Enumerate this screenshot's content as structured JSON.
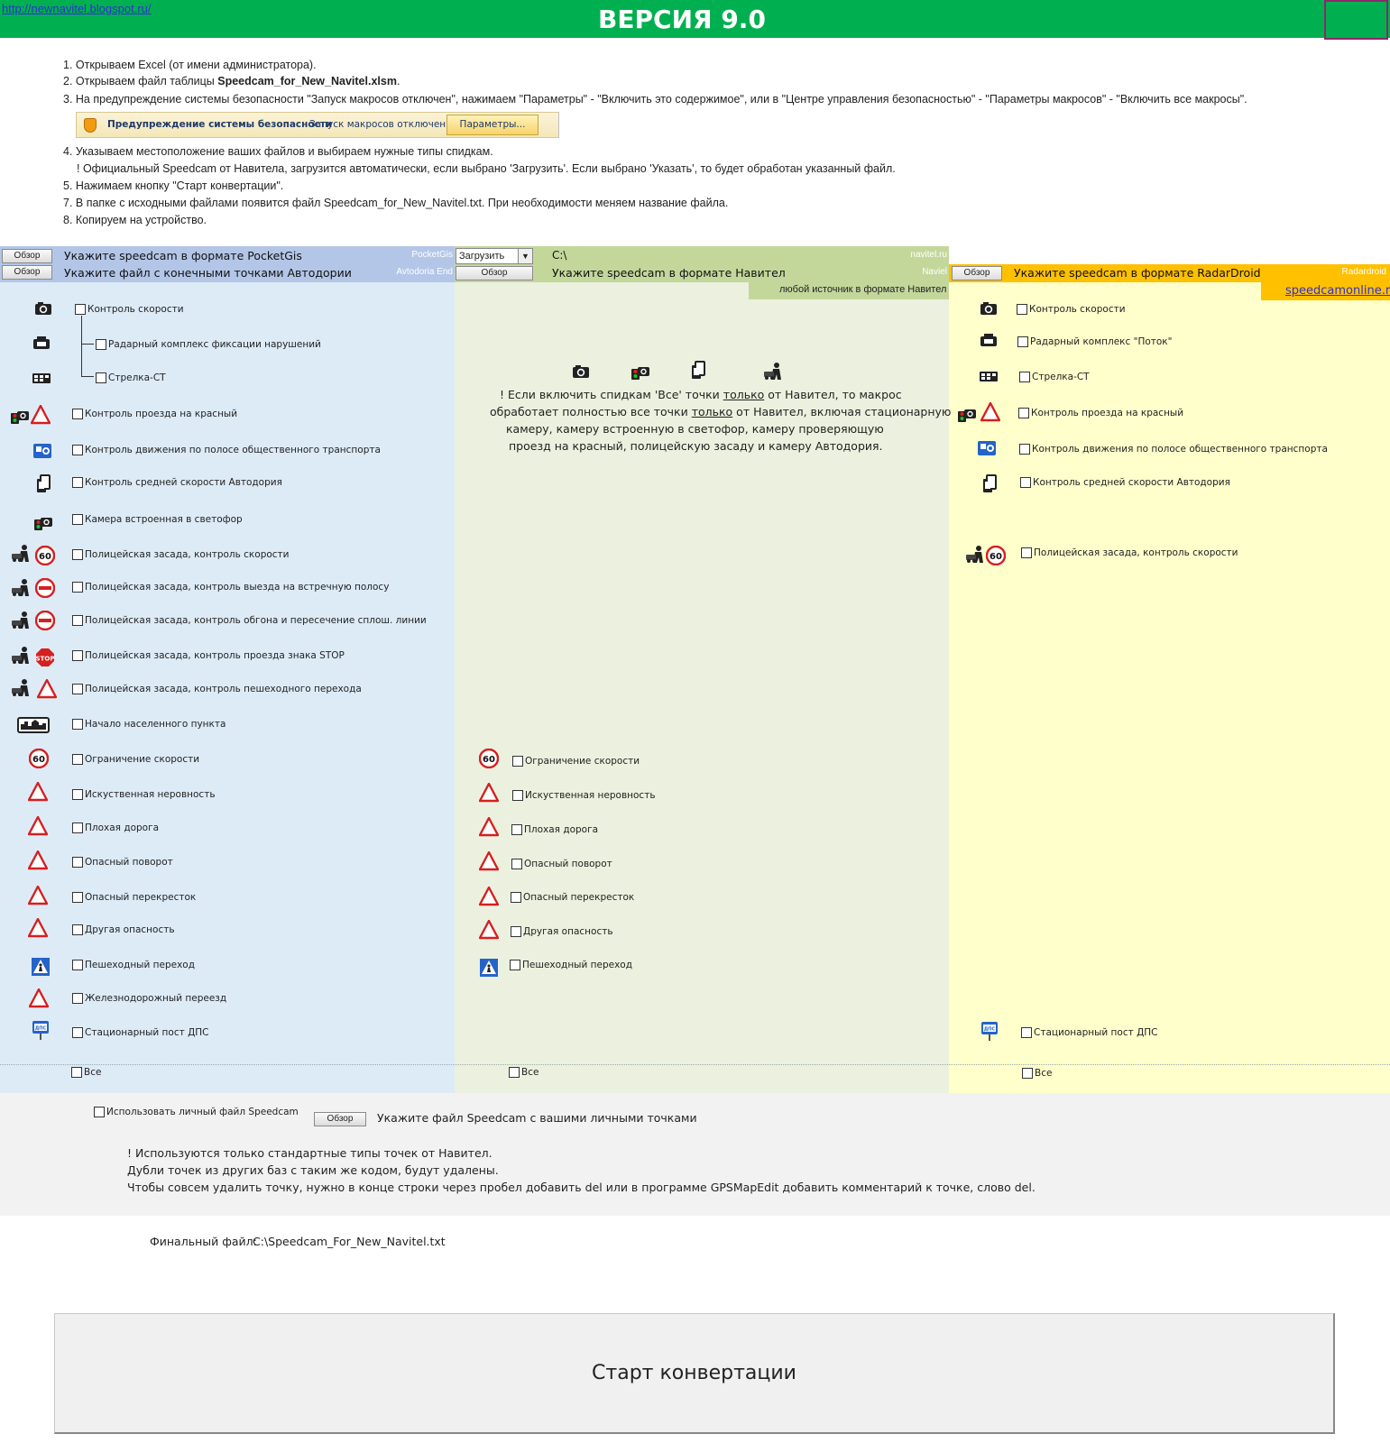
{
  "header": {
    "link": "http://newnavitel.blogspot.ru/",
    "title": "ВЕРСИЯ 9.0"
  },
  "instructions": {
    "step1": "1. Открываем Excel (от имени администратора).",
    "step2_prefix": "2. Открываем файл таблицы ",
    "step2_file": "Speedcam_for_New_Navitel.xlsm",
    "step2_suffix": ".",
    "step3": "3. На предупреждение системы безопасности \"Запуск макросов отключен\", нажимаем \"Параметры\" - \"Включить это содержимое\", или в \"Центре управления безопасностью\" - \"Параметры макросов\" - \"Включить все макросы\".",
    "security_bar": {
      "title": "Предупреждение системы безопасности",
      "message": "Запуск макросов отключен.",
      "button": "Параметры..."
    },
    "step4": "4. Указываем местоположение ваших файлов и выбираем нужные типы спидкам.",
    "step4_note": "! Официальный Speedcam от Навитела, загрузится автоматически, если выбрано 'Загрузить'. Если выбрано 'Указать', то будет обработан указанный файл.",
    "step5": "5. Нажимаем кнопку \"Старт конвертации\".",
    "step7": "7. В папке с исходными файлами появится файл Speedcam_for_New_Navitel.txt. При необходимости меняем название файла.",
    "step8": "8. Копируем на устройство."
  },
  "browse_label": "Обзор",
  "pocketgis": {
    "label": "Укажите speedcam в формате PocketGis",
    "tag": "PocketGis"
  },
  "avtodoria": {
    "label": "Укажите файл с конечными точками Автодории",
    "tag": "Avtodoria End"
  },
  "navitel": {
    "mode": "Загрузить",
    "path": "C:\\",
    "tag1": "navitel.ru",
    "label": "Укажите speedcam в формате Навител",
    "tag2": "Naviel",
    "any_source": "любой источник в формате Навител",
    "notice": {
      "l1a": "! Если включить спидкам 'Все' точки ",
      "l1b": "только",
      "l1c": " от Навител, то макрос",
      "l2a": "обработает полностью все точки ",
      "l2b": "только",
      "l2c": " от Навител, включая стационарную",
      "l3": "камеру, камеру встроенную в светофор, камеру проверяющую",
      "l4": "проезд на красный, полицейскую засаду и камеру Автодория."
    }
  },
  "radardroid": {
    "label": "Укажите speedcam в формате RadarDroid",
    "tag": "Radardroid",
    "link": "speedcamonline.ru"
  },
  "pocketgis_items": {
    "speed_control": "Контроль скорости",
    "radar_complex": "Радарный комплекс фиксации нарушений",
    "strelka": "Стрелка-СТ",
    "red_light": "Контроль проезда на красный",
    "bus_lane": "Контроль движения по полосе общественного транспорта",
    "avg_speed": "Контроль средней скорости Автодория",
    "traffic_light_cam": "Камера встроенная в светофор",
    "police_speed": "Полицейская засада, контроль скорости",
    "police_oncoming": "Полицейская засада, контроль выезда на встречную полосу",
    "police_overtake": "Полицейская засада, контроль обгона и пересечение сплош. линии",
    "police_stop": "Полицейская засада, контроль проезда знака STOP",
    "police_pedestrian": "Полицейская засада, контроль пешеходного перехода",
    "settlement": "Начало населенного пункта",
    "speed_limit": "Ограничение скорости",
    "bump": "Искуственная неровность",
    "bad_road": "Плохая дорога",
    "dangerous_turn": "Опасный поворот",
    "dangerous_crossroad": "Опасный перекресток",
    "other_danger": "Другая опасность",
    "pedestrian_crossing": "Пешеходный переход",
    "railway": "Железнодорожный переезд",
    "dps_post": "Стационарный пост ДПС",
    "all": "Все"
  },
  "navitel_items": {
    "speed_limit": "Ограничение скорости",
    "bump": "Искуственная неровность",
    "bad_road": "Плохая дорога",
    "dangerous_turn": "Опасный поворот",
    "dangerous_crossroad": "Опасный перекресток",
    "other_danger": "Другая опасность",
    "pedestrian_crossing": "Пешеходный переход",
    "all": "Все"
  },
  "radardroid_items": {
    "speed_control": "Контроль скорости",
    "potok": "Радарный комплекс \"Поток\"",
    "strelka": "Стрелка-СТ",
    "red_light": "Контроль проезда на красный",
    "bus_lane": "Контроль движения по полосе общественного транспорта",
    "avg_speed": "Контроль средней скорости Автодория",
    "police_speed": "Полицейская засада, контроль скорости",
    "dps_post": "Стационарный пост ДПС",
    "all": "Все"
  },
  "personal": {
    "use_label": "Использовать личный файл Speedcam",
    "file_label": "Укажите файл Speedcam с вашими личными точками",
    "note1": "! Используются только стандартные типы точек от Навител.",
    "note2": "Дубли точек из других баз с таким же кодом, будут удалены.",
    "note3": "Чтобы совсем удалить точку, нужно в конце строки через пробел добавить del или в программе GPSMapEdit добавить комментарий к точке, слово del."
  },
  "final": {
    "label": "Финальный файл:",
    "path": "C:\\Speedcam_For_New_Navitel.txt"
  },
  "start_button": "Старт конвертации",
  "colors": {
    "header_green": "#00b050",
    "col1_bg": "#ddebf7",
    "col2_bg": "#ebf1de",
    "col3_bg": "#ffffcc",
    "col3_header": "#ffc000"
  }
}
